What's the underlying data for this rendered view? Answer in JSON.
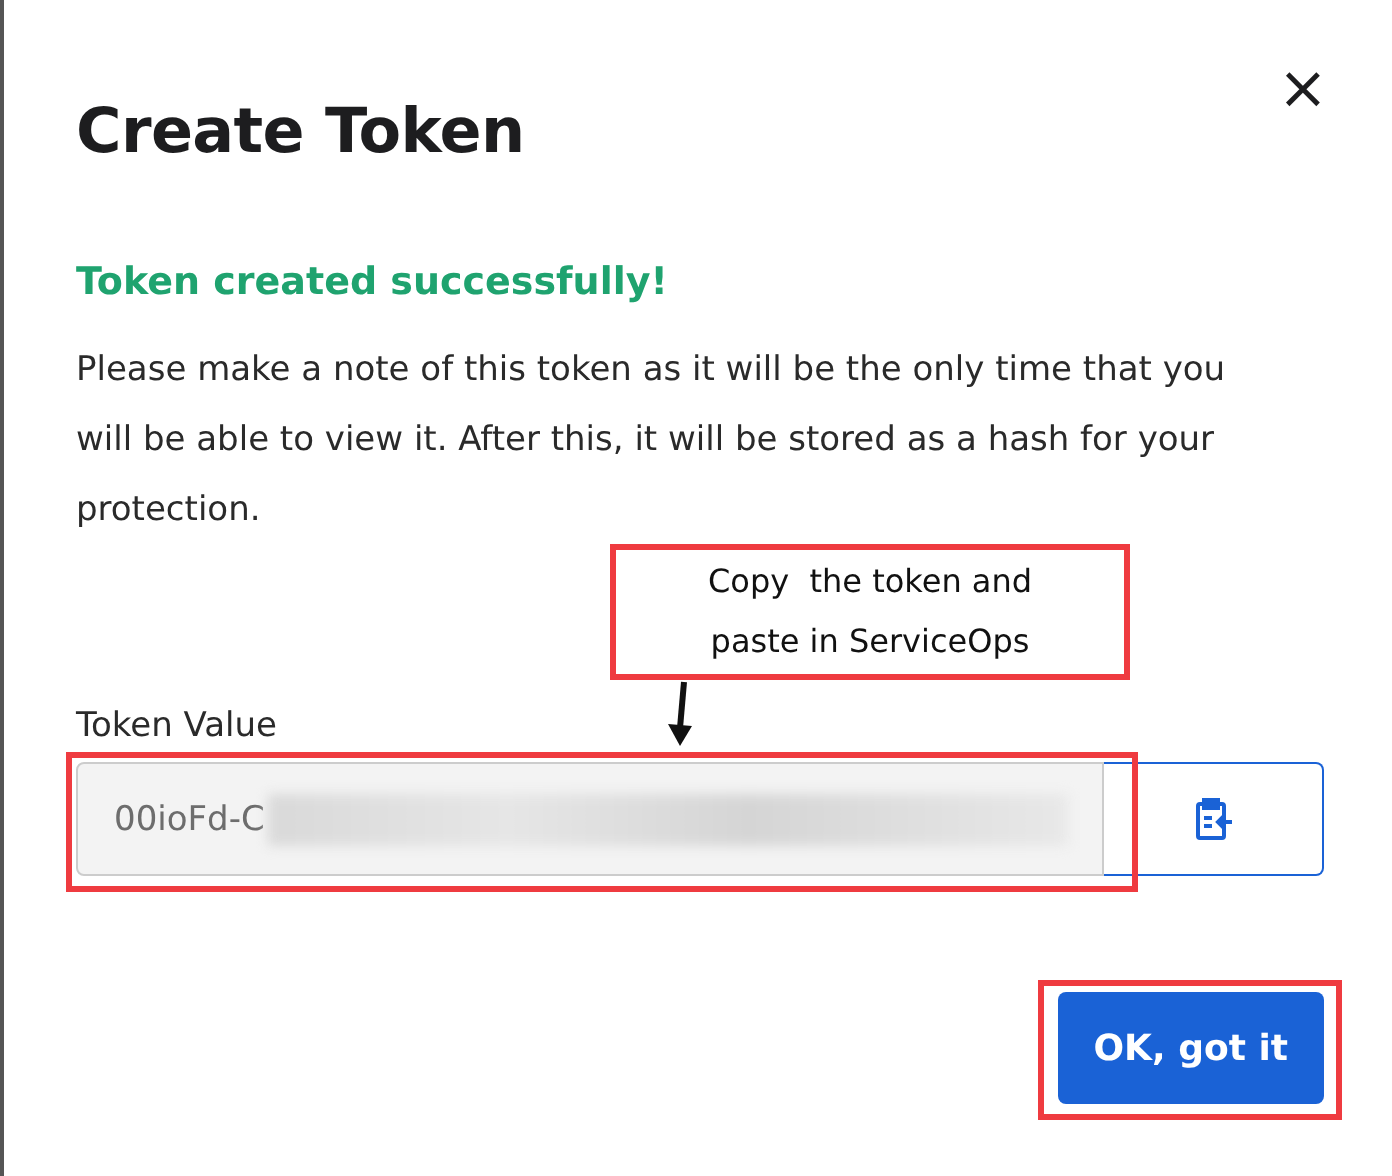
{
  "dialog": {
    "title": "Create Token",
    "close": "×",
    "success": "Token created successfully!",
    "message": "Please make a note of this token as it will be the only time that you will be able to view it. After this, it will be stored as a hash for your protection.",
    "field": {
      "label": "Token Value",
      "value": "00ioFd-C",
      "masked": true
    },
    "confirm": "OK, got it"
  },
  "annotations": [
    {
      "kind": "callout",
      "text": "Copy  the token and paste in ServiceOps"
    },
    {
      "kind": "field_highlight"
    },
    {
      "kind": "button_highlight"
    }
  ]
}
